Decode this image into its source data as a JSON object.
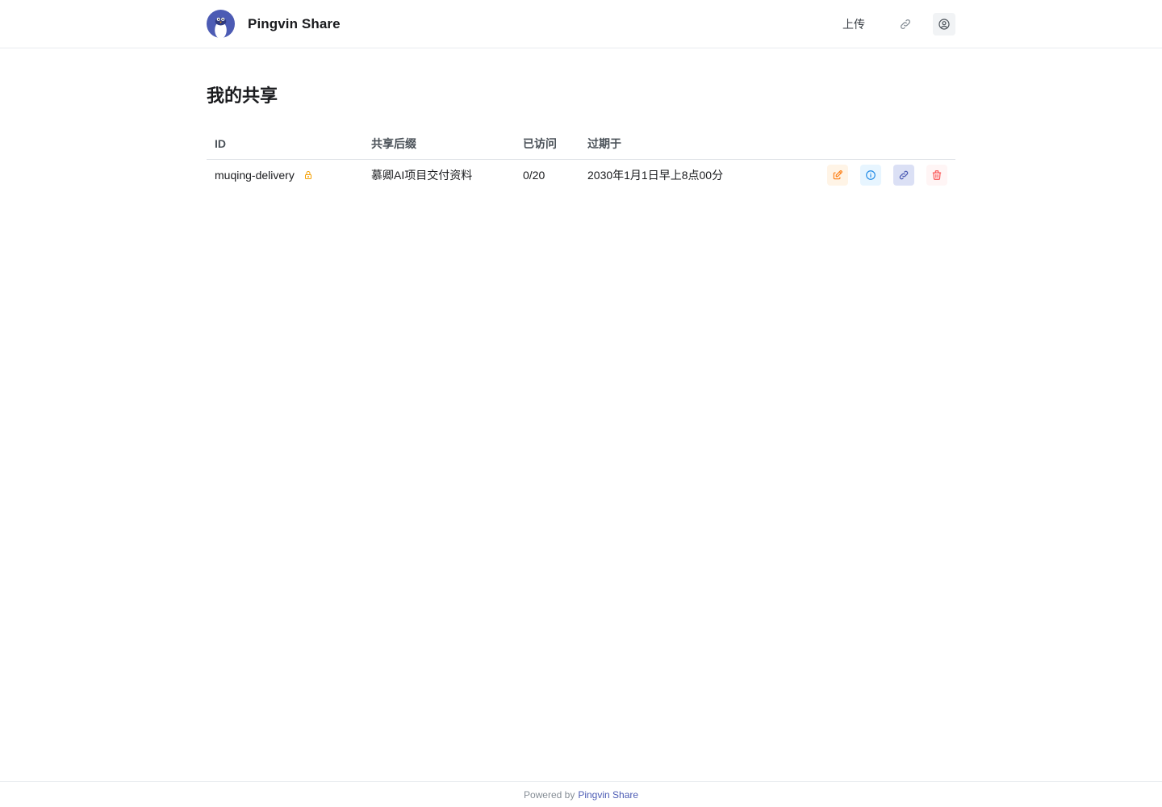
{
  "header": {
    "brand_name": "Pingvin Share",
    "nav": {
      "upload_label": "上传"
    },
    "icons": {
      "logo": "penguin-logo",
      "link": "link-icon",
      "user": "user-circle-icon"
    }
  },
  "page": {
    "title": "我的共享"
  },
  "table": {
    "headers": {
      "id": "ID",
      "name": "共享后缀",
      "views": "已访问",
      "expires": "过期于"
    },
    "rows": [
      {
        "id": "muqing-delivery",
        "name": "慕卿AI项目交付资料",
        "views": "0/20",
        "expires": "2030年1月1日早上8点00分",
        "protected_icon": "lock-icon"
      }
    ],
    "action_icons": [
      "edit-icon",
      "info-icon",
      "link-icon",
      "trash-icon"
    ]
  },
  "colors": {
    "accent": "#4c5bb4",
    "lock": "#f59f00",
    "edit": "#fd7e14",
    "info": "#228be6",
    "delete": "#fa5252"
  },
  "footer": {
    "prefix": "Powered by",
    "link_label": "Pingvin Share"
  }
}
